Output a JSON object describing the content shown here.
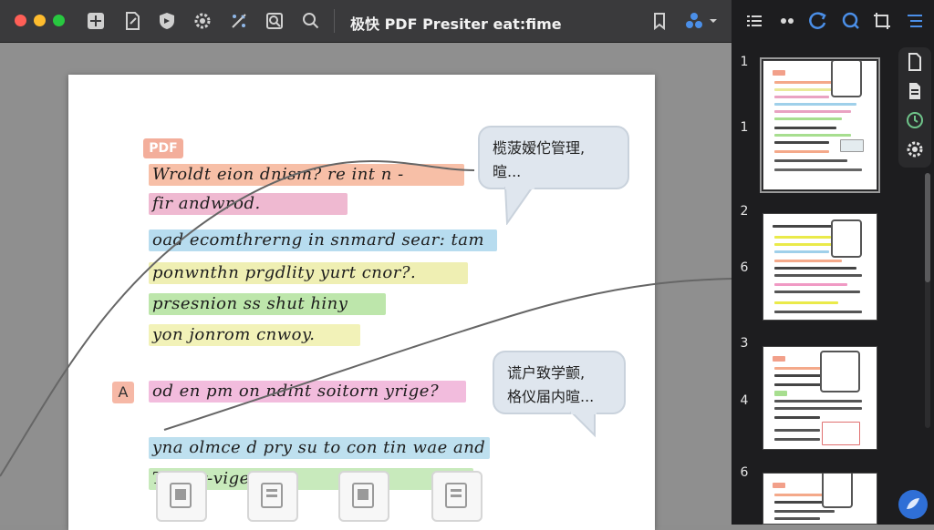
{
  "window": {
    "title": "极快 PDF Presiter eat:fime",
    "traffic_lights": [
      "close",
      "minimize",
      "zoom"
    ]
  },
  "toolbar": {
    "left_icons": [
      "add-page-icon",
      "edit-document-icon",
      "shield-icon",
      "gear-icon",
      "magic-tools-icon",
      "zoom-page-icon",
      "search-icon"
    ],
    "right_icons": [
      "bookmark-icon",
      "share-dropdown-icon"
    ]
  },
  "sidebar_toolbar": {
    "icons": [
      "list-icon",
      "dots-icon",
      "rotate-icon",
      "ocr-search-icon",
      "crop-icon",
      "outline-icon"
    ]
  },
  "document": {
    "badge": "PDF",
    "marker": "A",
    "lines": [
      {
        "text": "Wroldt eion dnism? re int n -",
        "color": "#f4a98a"
      },
      {
        "text": "fir andwrod.",
        "color": "#e9a2c2"
      },
      {
        "text": "oad ecomthrerng in snmard sear: tam",
        "color": "#9fd0ea"
      },
      {
        "text": "ponwnthn prgdlity yurt cnor?.",
        "color": "#eaea9a"
      },
      {
        "text": "prsesnion ss shut hiny",
        "color": "#a7de8f"
      },
      {
        "text": "yon jonrom cnwoy.",
        "color": "#eeeea0"
      },
      {
        "text": "od en pm on ndint soitorn yrige?",
        "color": "#eea6d2"
      },
      {
        "text": "yna olmce d pry su to con tin wae and",
        "color": "#a8d6ea"
      },
      {
        "text": "Ter fir-vige.",
        "color": "#b6e3a6"
      }
    ],
    "comments": [
      {
        "line1": "榄菠嫒佗管理,",
        "line2": "暄..."
      },
      {
        "line1": "谎户致学颤,",
        "line2": "格仪届内暄..."
      }
    ]
  },
  "thumbnails": {
    "page_labels": [
      "1",
      "1",
      "2",
      "6",
      "3",
      "4",
      "6"
    ]
  },
  "right_rail": {
    "icons": [
      "document-icon",
      "notes-icon",
      "history-icon",
      "settings-icon"
    ]
  },
  "colors": {
    "titlebar": "#3a3a3c",
    "sidebar": "#1d1d1f",
    "canvas": "#8f8f8f",
    "accent": "#2f6fd6"
  }
}
